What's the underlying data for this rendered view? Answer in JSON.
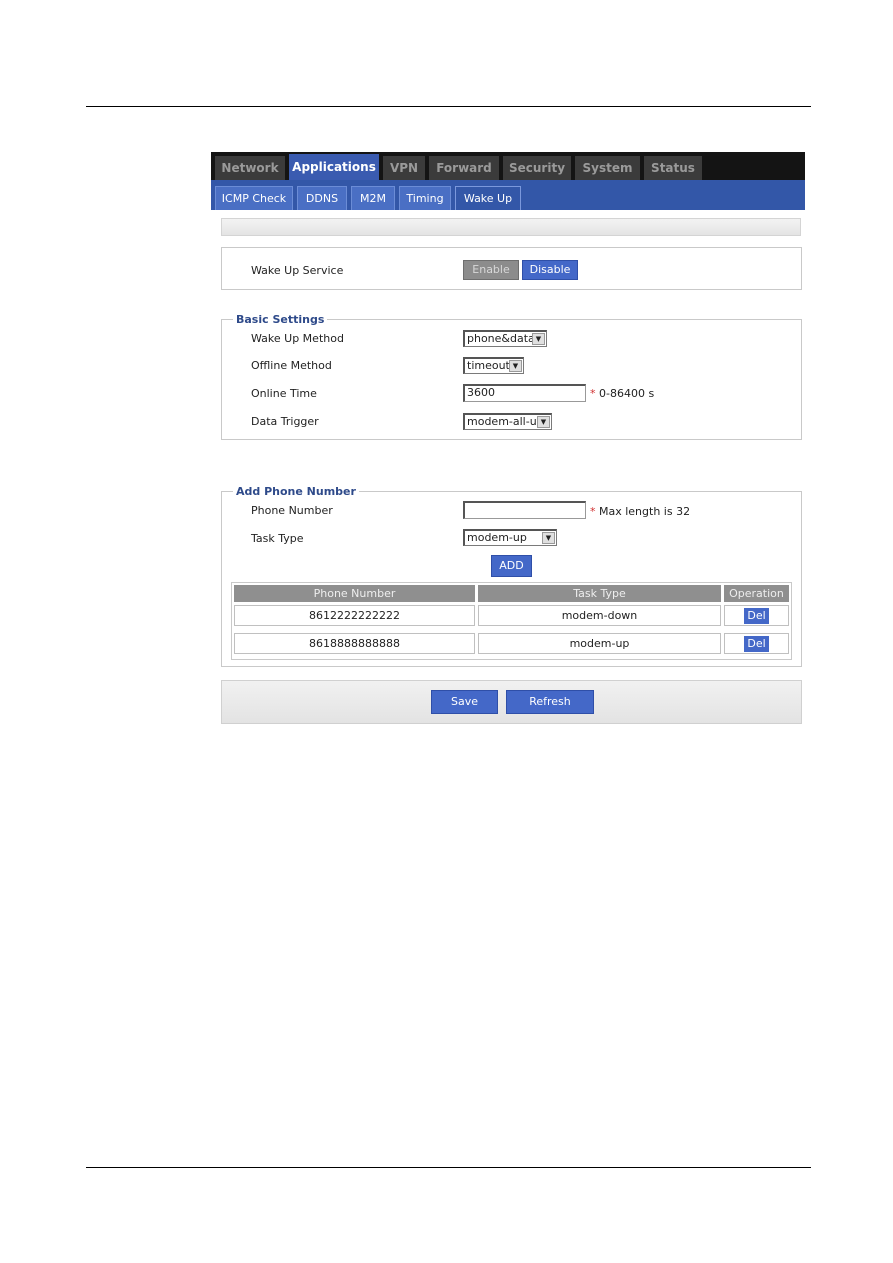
{
  "top_nav": {
    "tabs": [
      {
        "label": "Network",
        "active": false
      },
      {
        "label": "Applications",
        "active": true
      },
      {
        "label": "VPN",
        "active": false
      },
      {
        "label": "Forward",
        "active": false
      },
      {
        "label": "Security",
        "active": false
      },
      {
        "label": "System",
        "active": false
      },
      {
        "label": "Status",
        "active": false
      }
    ]
  },
  "sub_nav": {
    "tabs": [
      {
        "label": "ICMP Check",
        "active": false
      },
      {
        "label": "DDNS",
        "active": false
      },
      {
        "label": "M2M",
        "active": false
      },
      {
        "label": "Timing",
        "active": false
      },
      {
        "label": "Wake Up",
        "active": true
      }
    ]
  },
  "service": {
    "label": "Wake Up Service",
    "enable_label": "Enable",
    "disable_label": "Disable",
    "state": "Disable"
  },
  "basic_settings": {
    "legend": "Basic Settings",
    "wake_up_method": {
      "label": "Wake Up Method",
      "value": "phone&data"
    },
    "offline_method": {
      "label": "Offline Method",
      "value": "timeout"
    },
    "online_time": {
      "label": "Online Time",
      "value": "3600",
      "hint": "0-86400 s"
    },
    "data_trigger": {
      "label": "Data Trigger",
      "value": "modem-all-up"
    }
  },
  "add_phone": {
    "legend": "Add Phone Number",
    "phone_number": {
      "label": "Phone Number",
      "value": "",
      "hint": "Max length is 32"
    },
    "task_type": {
      "label": "Task Type",
      "value": "modem-up"
    },
    "add_label": "ADD",
    "required_mark": "*"
  },
  "phone_table": {
    "columns": [
      "Phone Number",
      "Task Type",
      "Operation"
    ],
    "rows": [
      {
        "phone": "8612222222222",
        "task": "modem-down",
        "op": "Del"
      },
      {
        "phone": "8618888888888",
        "task": "modem-up",
        "op": "Del"
      }
    ]
  },
  "footer": {
    "save_label": "Save",
    "refresh_label": "Refresh"
  },
  "colors": {
    "accent": "#4468c8",
    "nav_dark": "#141414",
    "subnav": "#3357a8",
    "required": "#d03030"
  }
}
